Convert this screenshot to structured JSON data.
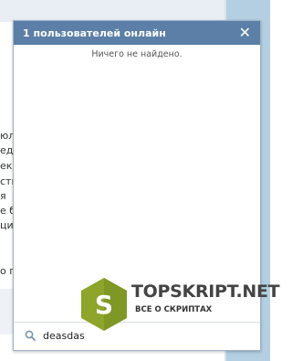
{
  "background": {
    "fragments": [
      "юл",
      "ед",
      "ек,",
      "ств",
      "я",
      "е б",
      "ци",
      "о по"
    ]
  },
  "popup": {
    "title": "1 пользователей онлайн",
    "close_icon": "close-icon",
    "empty_message": "Ничего не найдено.",
    "search": {
      "value": "deasdas",
      "icon": "search-icon"
    }
  },
  "watermark": {
    "letter": "S",
    "name": "TOPSKRIPT.NET",
    "tagline": "ВСЕ О СКРИПТАХ"
  }
}
